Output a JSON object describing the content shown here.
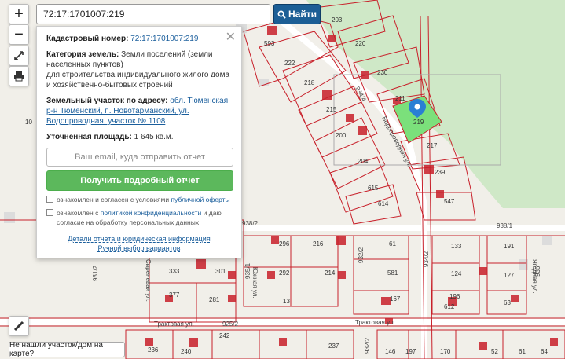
{
  "search": {
    "value": "72:17:1701007:219",
    "button_label": "Найти"
  },
  "controls": {
    "zoom_in": "+",
    "zoom_out": "−"
  },
  "panel": {
    "cadastral_label": "Кадастровый номер:",
    "cadastral_value": "72:17:1701007:219",
    "category_label": "Категория земель:",
    "category_value": "Земли поселений (земли населенных пунктов)",
    "usage": "для строительства индивидуального жилого дома и хозяйственно-бытовых строений",
    "address_label": "Земельный участок по адресу:",
    "address_value": "обл. Тюменская, р-н Тюменский, п. Новотарманский, ул. Водопроводная, участок № 1108",
    "area_label": "Уточненная площадь:",
    "area_value": "1 645 кв.м.",
    "email_placeholder": "Ваш email, куда отправить отчет",
    "report_button": "Получить подробный отчет",
    "consent1_a": "ознакомлен и согласен с условиями",
    "consent1_b": "публичной оферты",
    "consent2_a": "ознакомлен с",
    "consent2_b": "политикой конфиденциальности",
    "consent2_c": "и даю согласие на обработку персональных данных",
    "details_link": "Детали отчета и юридическая информация",
    "manual_link": "Ручной выбор вариантов"
  },
  "bottom_button": "Не нашли участок/дом на карте?",
  "map": {
    "streets": [
      "Трактовая ул.",
      "Трактовая ул.",
      "Водопроводная ул.",
      "Сиреневая ул.",
      "Южная ул.",
      "Ягодная ул."
    ],
    "parcels": [
      "593",
      "222",
      "218",
      "215",
      "200",
      "204",
      "615",
      "614",
      "203",
      "220",
      "230",
      "211",
      "219",
      "217",
      "239",
      "547",
      "296",
      "216",
      "292",
      "214",
      "61",
      "581",
      "167",
      "133",
      "124",
      "196",
      "191",
      "127",
      "63",
      "333",
      "301",
      "377",
      "281",
      "242",
      "236",
      "240",
      "237",
      "146",
      "197",
      "170",
      "52",
      "61",
      "64",
      "612",
      "13",
      "10"
    ],
    "lines": [
      "934/4",
      "938/1",
      "932/2",
      "931/2",
      "925/2",
      "938/2",
      "935/1",
      "932/2",
      "934/2",
      "936"
    ]
  },
  "colors": {
    "parcel_line": "#c8202a",
    "selected_fill": "#7be07b",
    "search_button": "#1c5e95",
    "report_button": "#5cb85c"
  }
}
